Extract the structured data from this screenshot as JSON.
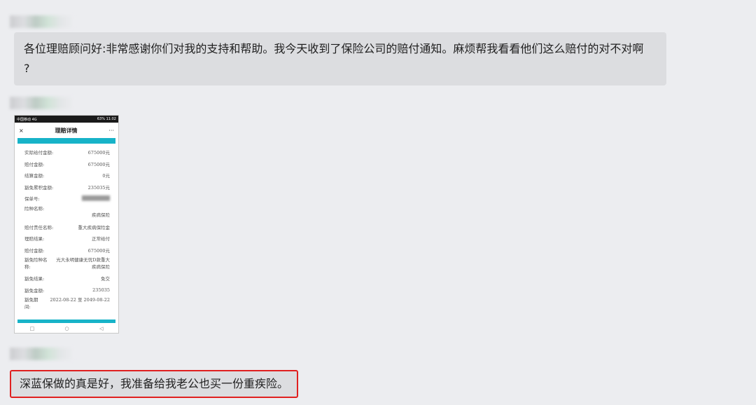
{
  "messages": [
    {
      "text": "各位理赔顾问好:非常感谢你们对我的支持和帮助。我今天收到了保险公司的赔付通知。麻烦帮我看看他们这么赔付的对不对啊",
      "text2": "?"
    },
    {
      "text": "深蓝保做的真是好，我准备给我老公也买一份重疾险。"
    }
  ],
  "phone": {
    "status_left": "中国移动 4G",
    "status_right": "63% 11:02",
    "close": "×",
    "title": "理赔详情",
    "more": "···",
    "rows": [
      {
        "label": "实际给付金额:",
        "value": "675000元"
      },
      {
        "label": "赔付金额:",
        "value": "675000元"
      },
      {
        "label": "结算金额:",
        "value": "0元"
      },
      {
        "label": "豁免累积金额:",
        "value": "235035元"
      },
      {
        "label": "保单号:",
        "value": ""
      },
      {
        "label": "险种名称:",
        "value": "疾病保险"
      },
      {
        "label": "赔付责任名称:",
        "value": "重大疾病保险金"
      },
      {
        "label": "理赔结果:",
        "value": "正常给付"
      },
      {
        "label": "赔付金额:",
        "value": "675000元"
      },
      {
        "label": "豁免险种名称:",
        "value": "光大永明健康无忧D款重大疾病保险"
      },
      {
        "label": "豁免结果:",
        "value": "免交"
      },
      {
        "label": "豁免金额:",
        "value": "235035"
      },
      {
        "label": "豁免期间:",
        "value": "2022-08-22 至 2049-08-22"
      }
    ],
    "nav": [
      "□",
      "○",
      "◁"
    ]
  }
}
